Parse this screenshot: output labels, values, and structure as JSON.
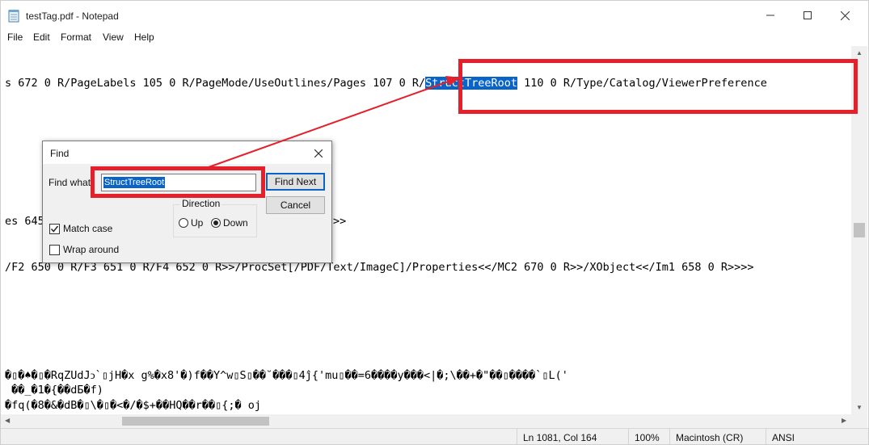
{
  "window": {
    "title": "testTag.pdf - Notepad",
    "icon": "notepad-icon",
    "controls": [
      "minimize-icon",
      "maximize-icon",
      "close-icon"
    ]
  },
  "menu": [
    "File",
    "Edit",
    "Format",
    "View",
    "Help"
  ],
  "editor": {
    "line1_before": "s 672 0 R/PageLabels 105 0 R/PageMode/UseOutlines/Pages 107 0 R/",
    "line1_selected": "StructTreeRoot",
    "line1_after": " 110 0 R/Type/Catalog/ViewerPreference",
    "line2_left": "es 645",
    "line2_right": ">>",
    "line3": "/F2 650 0 R/F3 651 0 R/F4 652 0 R>>/ProcSet[/PDF/Text/ImageC]/Properties<</MC2 670 0 R>>/XObject<</Im1 658 0 R>>>>",
    "binary1": "�▯�♠�▯�RqZUdJↄ`▯jH�x g%�x8'�)f��Y^w▯S▯��˘���▯4ĵ{'mu▯��=6����y���<|�;\\��+�\"��▯����`▯L('",
    "binary2": " ��_�1�{��dБ�f)",
    "binary3": "�fq(�8�&�dB�▯\\�▯�<�/�$+��HQ��r��▯{;� oj"
  },
  "find_dialog": {
    "title": "Find",
    "find_what_label": "Find what:",
    "find_what_value": "StructTreeRoot",
    "find_next_label": "Find Next",
    "cancel_label": "Cancel",
    "direction_label": "Direction",
    "up_label": "Up",
    "down_label": "Down",
    "direction_selected": "Down",
    "match_case_label": "Match case",
    "match_case_checked": true,
    "wrap_around_label": "Wrap around",
    "wrap_around_checked": false
  },
  "status": {
    "position": "Ln 1081, Col 164",
    "zoom": "100%",
    "line_ending": "Macintosh (CR)",
    "encoding": "ANSI"
  },
  "annotation": {
    "color": "#e5202a",
    "highlight_color": "#0a64c8"
  }
}
